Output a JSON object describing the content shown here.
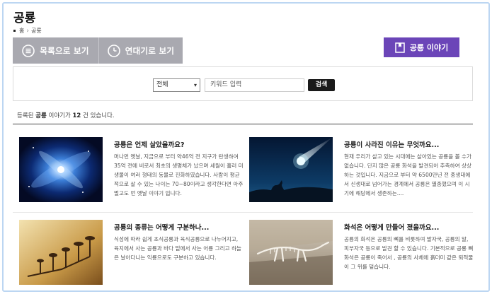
{
  "page": {
    "title": "공룡",
    "breadcrumb": [
      "홈",
      "공룡"
    ]
  },
  "toolbar": {
    "list_view_label": "목록으로 보기",
    "chrono_view_label": "연대기로 보기",
    "story_label": "공룡 이야기"
  },
  "search": {
    "selected_option": "전체",
    "placeholder": "키워드 입력",
    "button_label": "검색"
  },
  "summary": {
    "prefix": "등록된 ",
    "keyword": "공룡",
    "middle": " 이야기가 ",
    "count": "12",
    "suffix": " 건 있습니다."
  },
  "cards": [
    {
      "title": "공룡은 언제 살았을까요?",
      "desc": "머나먼 옛날, 지금으로 부터 약46억 전 지구가 탄생하여 35억 전에 비로서 최초의 생명체가 났으며 세월이 흘러 미생물이 여러 형태의 동물로 진화하였습니다. 사람이 평균적으로 살 수 있는 나이는 70~80이라고 생각한다면 아주 멀고도 먼 옛날 이야기 입니다.",
      "image": "galaxy-image"
    },
    {
      "title": "공룡이 사라진 이유는 무엇까요...",
      "desc": "현재 우리가 살고 있는 시대에는 살아있는 공룡을 볼 수가 없습니다. 단지 많은 공룡 화석을 발견되어 추측하여 상상하는 것입니다. 지금으로 부터 약 6500만년 전 중생대에서 신생대로 넘어가는 경계에서 공룡은 멸종했으며 이 시기에 해당에서 생존하는....",
      "image": "comet-image"
    },
    {
      "title": "공룡의 종류는 어떻게 구분하나...",
      "desc": "식성에 따라 쉽게 초식공룡과 육식공룡으로 나누어지고, 육지에서 사는 공룡과 바다 밑에서 사는 어룡 그리고 하늘은 날아다니는 익룡으로도 구분하고 있습니다.",
      "image": "evolution-tree-image"
    },
    {
      "title": "화석은 어떻게 만들어 졌을까요...",
      "desc": "공룡의 화석은 공룡의 뼈를 비롯하여 발자국, 공룡의 알, 피부자국 등으로 발견 할 수 있습니다. 기본적으로 공룡 뼈 화석은 공룡이 죽어서 , 공룡의 사체에 흙더미 같은 퇴적물이 그 위를 덮습니다.",
      "image": "fossil-image"
    }
  ],
  "colors": {
    "accent_purple": "#6b45b8",
    "view_button_gray": "#a9a9b0",
    "frame_border": "#bcd6f2"
  }
}
